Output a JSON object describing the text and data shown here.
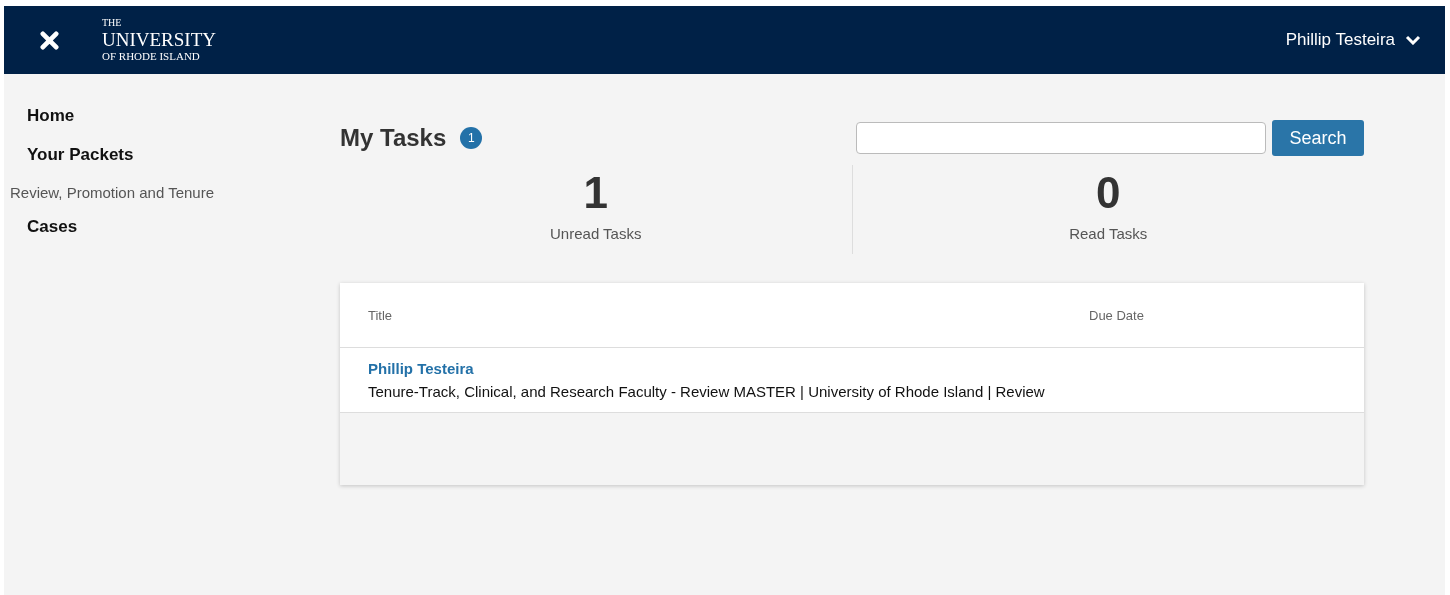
{
  "header": {
    "logo": {
      "line_1": "THE",
      "line_2": "UNIVERSITY",
      "line_3": "OF RHODE ISLAND"
    },
    "user_menu": "Phillip Testeira"
  },
  "sidebar": {
    "items": [
      {
        "label": "Home",
        "kind": "link"
      },
      {
        "label": "Your Packets",
        "kind": "link"
      },
      {
        "label": "Review, Promotion and Tenure",
        "kind": "heading"
      },
      {
        "label": "Cases",
        "kind": "link"
      }
    ]
  },
  "main": {
    "title": "My Tasks",
    "badge": "1",
    "search": {
      "button": "Search"
    },
    "stats": [
      {
        "value": "1",
        "label": "Unread Tasks"
      },
      {
        "value": "0",
        "label": "Read Tasks"
      }
    ],
    "table": {
      "columns": [
        "Title",
        "Due Date"
      ],
      "rows": [
        {
          "title": "Phillip Testeira",
          "description": "Tenure-Track, Clinical, and Research Faculty - Review MASTER | University of Rhode Island | Review"
        }
      ]
    }
  }
}
